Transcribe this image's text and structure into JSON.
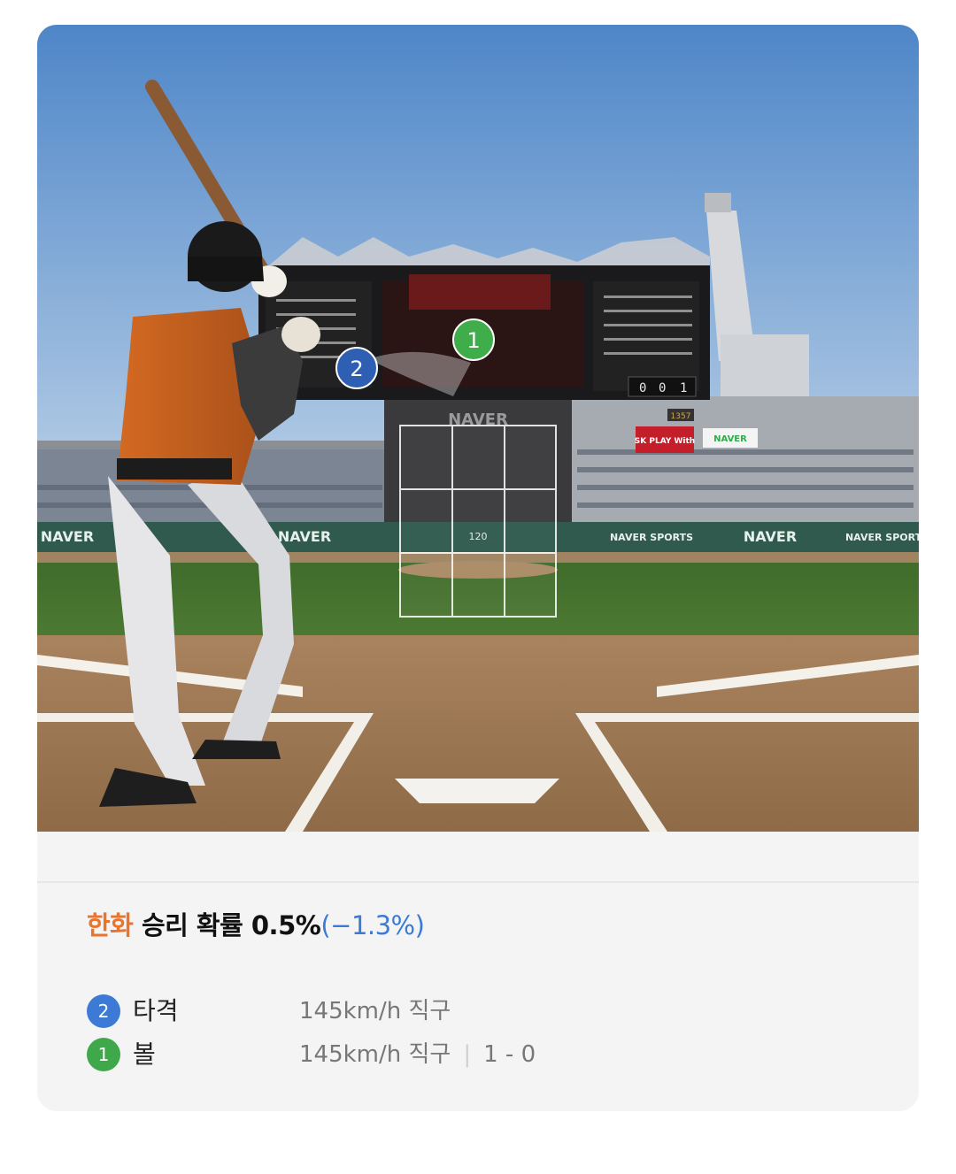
{
  "scene": {
    "stadium_banner_1": "NAVER",
    "stadium_banner_2": "NAVER SPORTS",
    "scoreboard_brand": "NAVER",
    "pitch_speed_readout": "120",
    "sponsor_sign": "SK PLAY With",
    "pitch_marker_1": "1",
    "pitch_marker_2": "2",
    "scoreboard_count": [
      "0",
      "0",
      "1"
    ],
    "board_number": "1357"
  },
  "summary": {
    "team": "한화",
    "label": " 승리 확률 0.5%",
    "delta": "(−1.3%)"
  },
  "pitches": [
    {
      "number": "2",
      "result": "타격",
      "speed": "145km/h 직구",
      "count": "",
      "color": "#3d7ad6"
    },
    {
      "number": "1",
      "result": "볼",
      "speed": "145km/h 직구",
      "count": "1 - 0",
      "color": "#3fa84a"
    }
  ],
  "colors": {
    "team": "#e8742e",
    "delta": "#3a7bd5",
    "strike_zone": "#ffffff"
  }
}
